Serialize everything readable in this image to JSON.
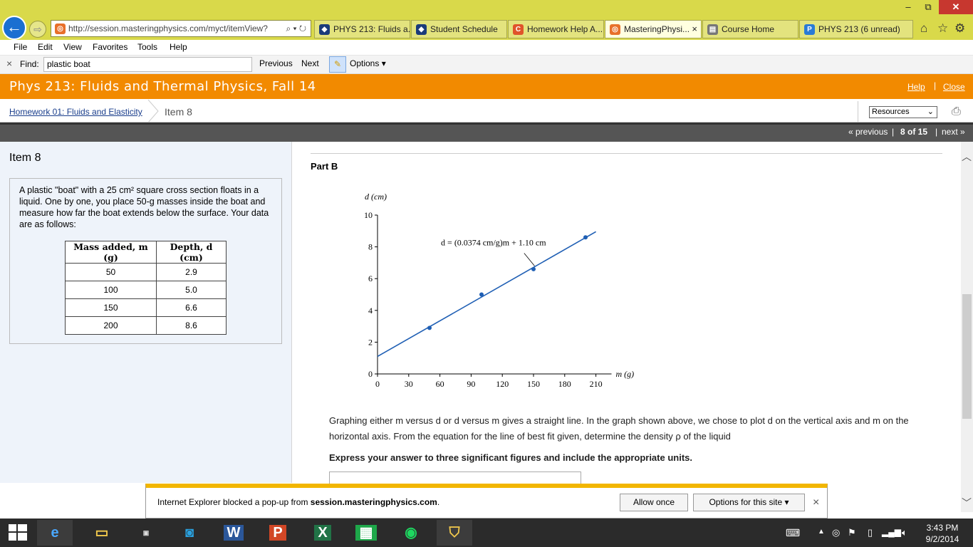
{
  "window": {
    "minimize": "–",
    "restore": "⧉",
    "close": "✕"
  },
  "browser": {
    "url": "http://session.masteringphysics.com/myct/itemView?",
    "tabs": [
      {
        "label": "PHYS 213: Fluids a...",
        "icon": "shield-icon"
      },
      {
        "label": "Student Schedule",
        "icon": "shield-icon"
      },
      {
        "label": "Homework Help A...",
        "icon": "c-icon"
      },
      {
        "label": "MasteringPhysi...",
        "icon": "mastering-icon",
        "close": "×"
      },
      {
        "label": "Course Home",
        "icon": "page-icon"
      },
      {
        "label": "PHYS 213 (6 unread)",
        "icon": "p-icon"
      }
    ],
    "menu": [
      "File",
      "Edit",
      "View",
      "Favorites",
      "Tools",
      "Help"
    ],
    "find": {
      "close": "×",
      "label": "Find:",
      "value": "plastic boat",
      "previous": "Previous",
      "next": "Next",
      "options": "Options"
    }
  },
  "course": {
    "title": "Phys 213: Fluids and Thermal Physics, Fall 14",
    "help": "Help",
    "close": "Close"
  },
  "breadcrumb": {
    "assignment": "Homework 01: Fluids and Elasticity",
    "item": "Item 8",
    "resources": "Resources"
  },
  "nav": {
    "previous": "« previous",
    "position": "8 of 15",
    "next": "next »"
  },
  "item": {
    "title": "Item 8",
    "problem_text": "A plastic \"boat\" with a 25 cm² square cross section floats in a liquid. One by one, you place 50-g masses inside the boat and measure how far the boat extends below the surface. Your data are as follows:",
    "table": {
      "headers": [
        "Mass added, m (g)",
        "Depth, d (cm)"
      ],
      "rows": [
        [
          "50",
          "2.9"
        ],
        [
          "100",
          "5.0"
        ],
        [
          "150",
          "6.6"
        ],
        [
          "200",
          "8.6"
        ]
      ]
    }
  },
  "part": {
    "title": "Part B",
    "description": "Graphing either m versus d or d versus m gives a straight line. In the graph shown above, we chose to plot d on the vertical axis and m on the horizontal axis. From the equation for the line of best fit given, determine the density ρ of the liquid",
    "instruction": "Express your answer to three significant figures and include the appropriate units."
  },
  "chart_data": {
    "type": "scatter",
    "xlabel": "m (g)",
    "ylabel": "d (cm)",
    "xlim": [
      0,
      225
    ],
    "ylim": [
      0,
      10
    ],
    "xticks": [
      0,
      30,
      60,
      90,
      120,
      150,
      180,
      210
    ],
    "yticks": [
      0,
      2,
      4,
      6,
      8,
      10
    ],
    "series": [
      {
        "x": [
          50,
          100,
          150,
          200
        ],
        "y": [
          2.9,
          5.0,
          6.6,
          8.6
        ]
      }
    ],
    "fit_line": {
      "slope": 0.0374,
      "intercept": 1.1,
      "x_range": [
        0,
        210
      ]
    },
    "annotation": "d = (0.0374 cm/g)m + 1.10 cm",
    "color": "#1f5fb4"
  },
  "popup": {
    "message_prefix": "Internet Explorer blocked a pop-up from ",
    "domain": "session.masteringphysics.com",
    "message_suffix": ".",
    "allow": "Allow once",
    "options": "Options for this site",
    "close": "×"
  },
  "taskbar": {
    "apps": [
      "ie-icon",
      "file-explorer-icon",
      "lenovo-icon",
      "store-icon",
      "word-icon",
      "powerpoint-icon",
      "excel-icon",
      "store-green-icon",
      "spotify-icon",
      "security-icon"
    ],
    "time": "3:43 PM",
    "date": "9/2/2014"
  }
}
